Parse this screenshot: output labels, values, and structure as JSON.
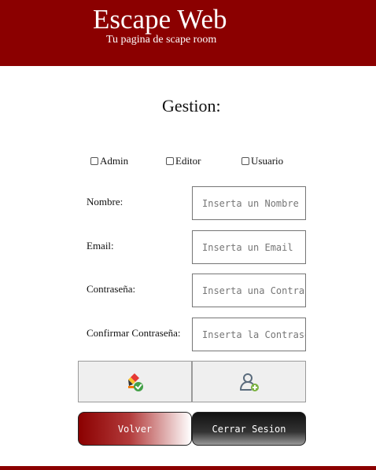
{
  "header": {
    "title": "Escape Web",
    "subtitle": "Tu pagina de scape room"
  },
  "page": {
    "title": "Gestion:"
  },
  "roles": [
    {
      "label": "Admin",
      "checked": false
    },
    {
      "label": "Editor",
      "checked": false
    },
    {
      "label": "Usuario",
      "checked": false
    }
  ],
  "form": {
    "nombre": {
      "label": "Nombre:",
      "placeholder": "Inserta un Nombre"
    },
    "email": {
      "label": "Email:",
      "placeholder": "Inserta un Email"
    },
    "password": {
      "label": "Contraseña:",
      "placeholder": "Inserta una Contraseña"
    },
    "confirm": {
      "label": "Confirmar Contraseña:",
      "placeholder": "Inserta la Contraseña"
    }
  },
  "icons": {
    "edit": "pencil-check-icon",
    "add_user": "add-user-icon"
  },
  "actions": {
    "back": "Volver",
    "logout": "Cerrar Sesion"
  },
  "colors": {
    "brand": "#8b0000",
    "white": "#ffffff",
    "field_border": "#767676"
  }
}
